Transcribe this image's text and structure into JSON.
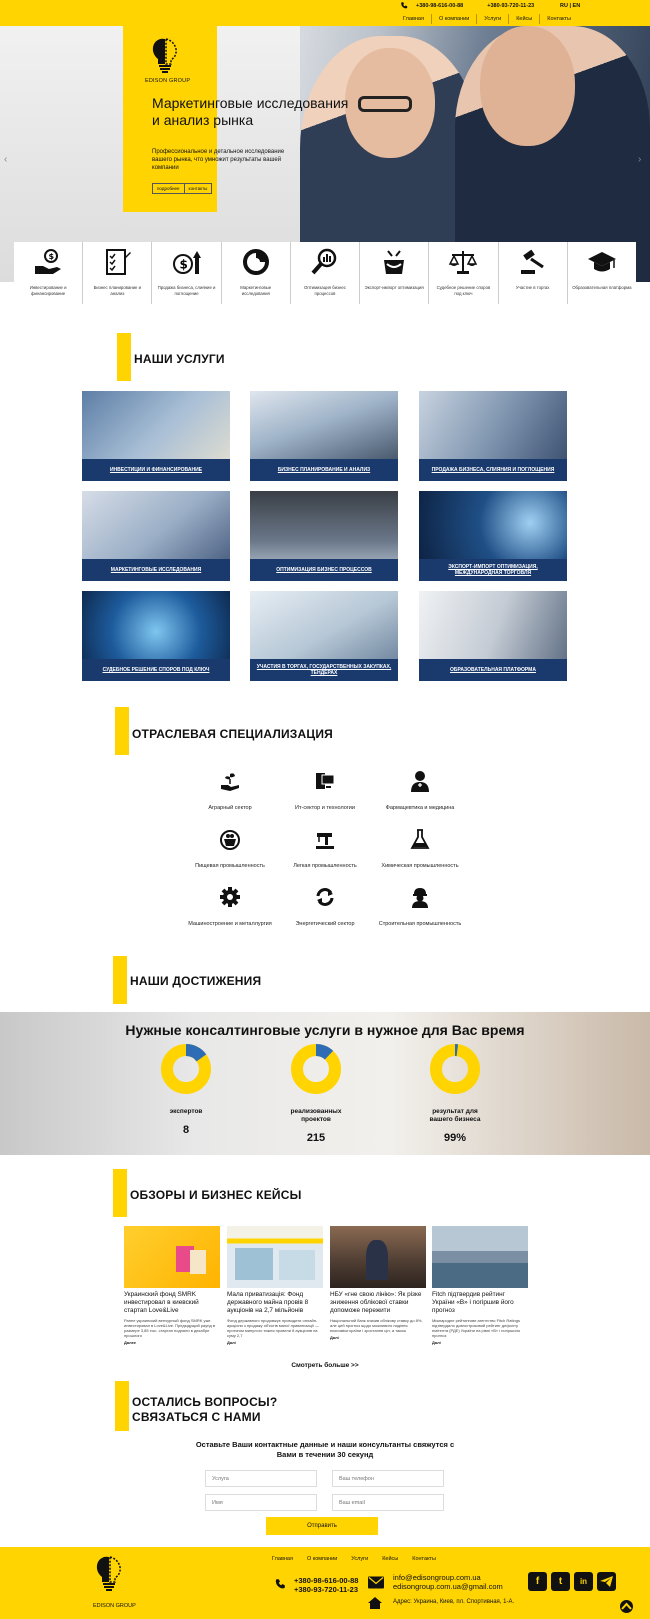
{
  "header": {
    "phones": [
      "+380-98-616-00-88",
      "+380-93-720-11-23"
    ],
    "lang": "RU | EN",
    "nav": [
      "Главная",
      "О компании",
      "Услуги",
      "Кейсы",
      "Контакты"
    ]
  },
  "hero": {
    "logo_text": "EDISON GROUP",
    "title": "Маркетинговые исследования и анализ рынка",
    "subtitle": "Профессиональное и детальное исследование вашего рынка, что умножит результаты вашей компании",
    "btn_more": "подробнее",
    "btn_contact": "контакты"
  },
  "strip": [
    {
      "label": "Инвестирование и финансирование",
      "icon": "money-hand-icon"
    },
    {
      "label": "Бизнес планирование и анализ",
      "icon": "checklist-icon"
    },
    {
      "label": "Продажа бизнеса, слияние и поглощение",
      "icon": "dollar-growth-icon"
    },
    {
      "label": "Маркетинговые исследования",
      "icon": "pie-chart-icon"
    },
    {
      "label": "Оптимизация бизнес процессов",
      "icon": "magnifier-chart-icon"
    },
    {
      "label": "Экспорт-импорт оптимизация",
      "icon": "box-arrows-icon"
    },
    {
      "label": "Судебное решение споров под ключ",
      "icon": "scales-icon"
    },
    {
      "label": "Участие в торгах",
      "icon": "gavel-icon"
    },
    {
      "label": "Образовательная платформа",
      "icon": "graduation-cap-icon"
    }
  ],
  "services": {
    "title": "НАШИ УСЛУГИ",
    "items": [
      "ИНВЕСТИЦИИ И ФИНАНСИРОВАНИЕ",
      "БИЗНЕС ПЛАНИРОВАНИЕ И АНАЛИЗ",
      "ПРОДАЖА БИЗНЕСА, СЛИЯНИЯ И ПОГЛОЩЕНИЯ",
      "МАРКЕТИНГОВЫЕ ИССЛЕДОВАНИЯ",
      "ОПТИМИЗАЦИЯ БИЗНЕС ПРОЦЕССОВ",
      "ЭКСПОРТ-ИМПОРТ ОПТИМИЗАЦИЯ, МЕЖДУНАРОДНАЯ ТОРГОВЛЯ",
      "СУДЕБНОЕ РЕШЕНИЕ СПОРОВ ПОД КЛЮЧ",
      "УЧАСТИЯ В ТОРГАХ, ГОСУДАРСТВЕННЫХ ЗАКУПКАХ, ТЕНДЕРАХ",
      "ОБРАЗОВАТЕЛЬНАЯ ПЛАТФОРМА"
    ]
  },
  "specialization": {
    "title": "ОТРАСЛЕВАЯ СПЕЦИАЛИЗАЦИЯ",
    "items": [
      {
        "label": "Аграрный сектор",
        "icon": "plant-hand-icon"
      },
      {
        "label": "Ит-сектор и технологии",
        "icon": "computer-icon"
      },
      {
        "label": "Фармацевтика и медицина",
        "icon": "doctor-icon"
      },
      {
        "label": "Пищевая промышленность",
        "icon": "food-basket-icon"
      },
      {
        "label": "Легкая промышленность",
        "icon": "sewing-machine-icon"
      },
      {
        "label": "Химическая промышленность",
        "icon": "flask-icon"
      },
      {
        "label": "Машиностроение и металлургия",
        "icon": "gear-icon"
      },
      {
        "label": "Энергетический сектор",
        "icon": "recycle-icon"
      },
      {
        "label": "Строительная промышленность",
        "icon": "builder-icon"
      }
    ]
  },
  "achievements": {
    "title": "НАШИ ДОСТИЖЕНИЯ",
    "headline": "Нужные консалтинговые услуги в нужное для Вас время",
    "items": [
      {
        "label": "экспертов",
        "value": "8",
        "fill": 0.15
      },
      {
        "label": "реализованных проектов",
        "value": "215",
        "fill": 0.12
      },
      {
        "label": "результат для вашего бизнеса",
        "value": "99%",
        "fill": 0.02
      }
    ],
    "colors": {
      "yellow": "#ffd400",
      "blue": "#2e6db5"
    }
  },
  "reviews": {
    "title": "ОБЗОРЫ И БИЗНЕС КЕЙСЫ",
    "items": [
      {
        "title": "Украинский фонд SMRK инвестировал в киевский стартап Love&Live",
        "desc": "Ранее украинский венчурный фонд SMRK уже инвестировал в Love&Live. Предыдущий раунд в размере 3,85 тыс. стартап подняли в декабре прошлого",
        "more": "Далее"
      },
      {
        "title": "Мала приватизація: Фонд державного майна провів 8 аукціонів на 2,7 мільйонів",
        "desc": "Фонд державного продовжує проводити онлайн-аукціони з продажу об'єктів малої приватизації — протягом минулого тижня провели 8 аукціонів на суму 2,7",
        "more": "Далі"
      },
      {
        "title": "НБУ «гне свою лінію»: Як різке зниження облікової ставки допоможе пережити",
        "desc": "Національний банк знизив облікову ставку до 8%, але цей прогноз щодо можливого падіння економіки країни і зростання цін, а також",
        "more": "Далі"
      },
      {
        "title": "Fitch підтвердив рейтинг України «B» і погіршив його прогноз",
        "desc": "Міжнародне рейтингове агентство Fitch Ratings підтвердило довгостроковий рейтинг дефолту емітента (РДЕ) України на рівні «B» і погіршило прогноз",
        "more": "Далі"
      }
    ],
    "more": "Смотреть больше >>"
  },
  "contact": {
    "title_line1": "ОСТАЛИСЬ ВОПРОСЫ?",
    "title_line2": "СВЯЗАТЬСЯ С НАМИ",
    "text": "Оставьте Ваши контактные данные и наши консультанты свяжутся с Вами в течении 30 секунд",
    "ph_service": "Услуга",
    "ph_phone": "Ваш телефон",
    "ph_name": "Имя",
    "ph_email": "Ваш email",
    "send": "Отправить"
  },
  "footer": {
    "logo_text": "EDISON GROUP",
    "nav": [
      "Главная",
      "О компании",
      "Услуги",
      "Кейсы",
      "Контакты"
    ],
    "phones": [
      "+380-98-616-00-88",
      "+380-93-720-11-23"
    ],
    "emails": [
      "info@edisongroup.com.ua",
      "edisongroup.com.ua@gmail.com"
    ],
    "address": "Адрес: Украина, Киев, пл. Спортивная, 1-А."
  }
}
